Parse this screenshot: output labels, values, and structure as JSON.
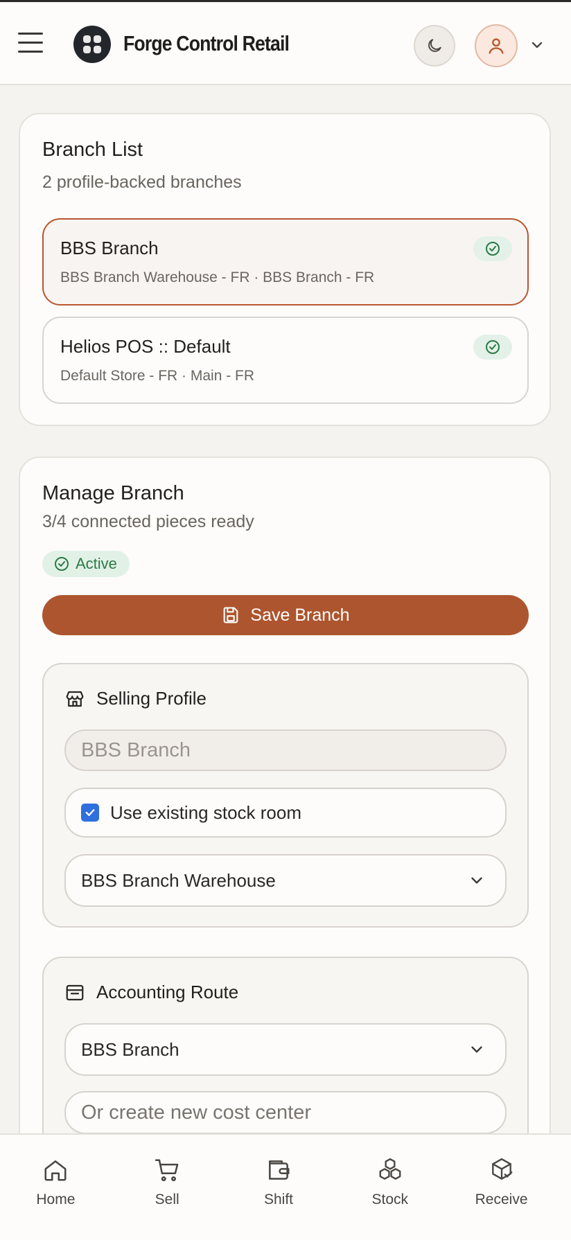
{
  "header": {
    "brand": "Forge Control Retail",
    "icons": {
      "menu": "hamburger-icon",
      "logo": "grid-logo-icon",
      "theme": "moon-icon",
      "user": "user-icon",
      "chevron": "chevron-down-icon"
    }
  },
  "branch_list": {
    "title": "Branch List",
    "subtitle": "2 profile-backed branches",
    "items": [
      {
        "name": "BBS Branch",
        "meta": "BBS Branch Warehouse - FR · BBS Branch - FR",
        "selected": true
      },
      {
        "name": "Helios POS :: Default",
        "meta": "Default Store - FR · Main - FR",
        "selected": false
      }
    ]
  },
  "manage_branch": {
    "title": "Manage Branch",
    "subtitle": "3/4 connected pieces ready",
    "status": "Active",
    "save_label": "Save Branch",
    "selling_profile": {
      "title": "Selling Profile",
      "name_value": "BBS Branch",
      "checkbox_label": "Use existing stock room",
      "checkbox_checked": true,
      "warehouse_value": "BBS Branch Warehouse"
    },
    "accounting_route": {
      "title": "Accounting Route",
      "cost_center_value": "BBS Branch",
      "new_cost_center_placeholder": "Or create new cost center"
    }
  },
  "bottom_nav": [
    {
      "label": "Home",
      "icon": "home-icon"
    },
    {
      "label": "Sell",
      "icon": "cart-icon"
    },
    {
      "label": "Shift",
      "icon": "wallet-icon"
    },
    {
      "label": "Stock",
      "icon": "boxes-icon"
    },
    {
      "label": "Receive",
      "icon": "package-check-icon"
    }
  ],
  "colors": {
    "accent": "#ad552e",
    "success": "#2b7a47",
    "background": "#f5f3f0"
  }
}
